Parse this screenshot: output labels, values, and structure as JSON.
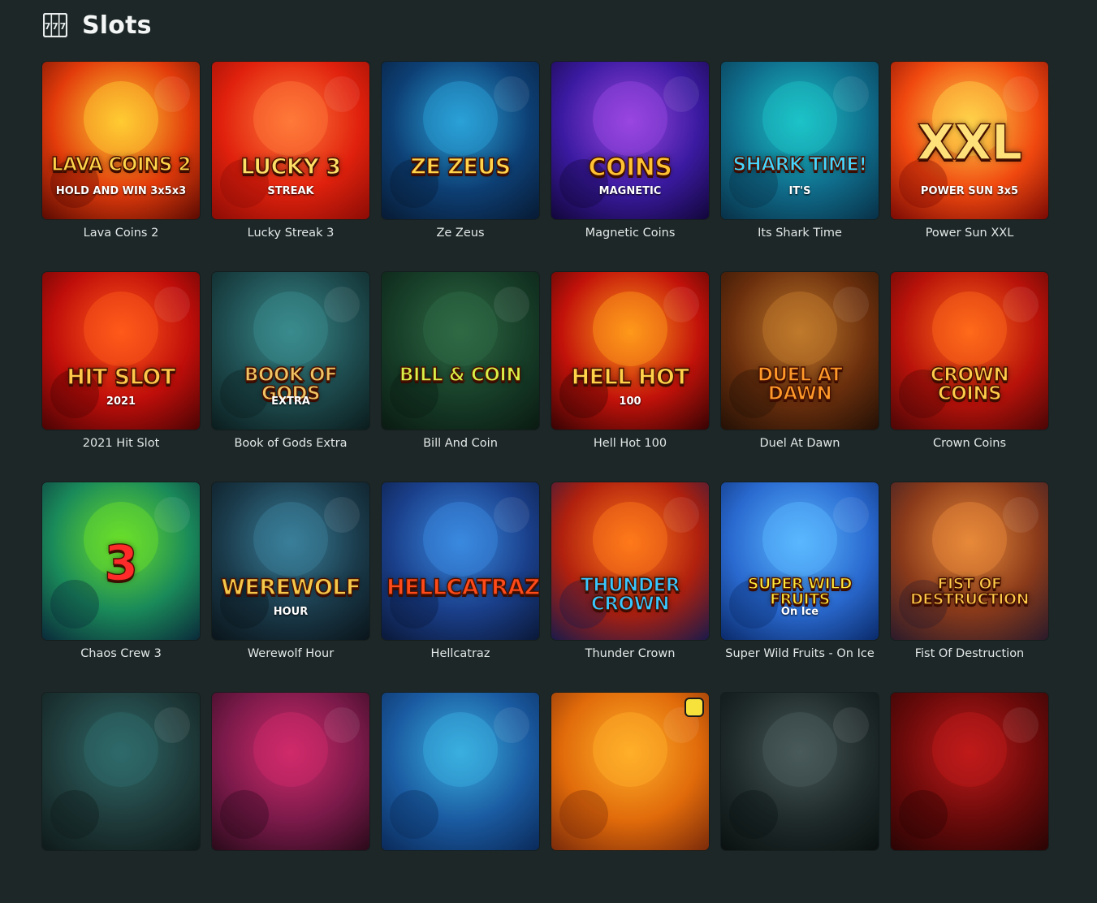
{
  "page": {
    "title": "Slots",
    "icon": "slot-machine-icon"
  },
  "games": [
    {
      "name": "Lava Coins 2",
      "logo": "Lava Coins 2",
      "sub": "HOLD AND WIN 3x5x3",
      "bg": [
        "#ffcc33",
        "#e23b0b",
        "#5a0a02"
      ],
      "logo_color": "#ffd54a"
    },
    {
      "name": "Lucky Streak 3",
      "logo": "Lucky 3",
      "sub": "STREAK",
      "bg": [
        "#ff7a3a",
        "#e0210d",
        "#8b0c05"
      ],
      "logo_color": "#ffe066"
    },
    {
      "name": "Ze Zeus",
      "logo": "Ze Zeus",
      "sub": "",
      "bg": [
        "#2aa1d8",
        "#0d3f74",
        "#071a33"
      ],
      "logo_color": "#ffd34a"
    },
    {
      "name": "Magnetic Coins",
      "logo": "Coins",
      "sub": "MAGNETIC",
      "bg": [
        "#9a46e0",
        "#3a1aa0",
        "#12063a"
      ],
      "logo_color": "#ffc233"
    },
    {
      "name": "Its Shark Time",
      "logo": "Shark Time!",
      "sub": "IT'S",
      "bg": [
        "#1cc3c8",
        "#0f6c8a",
        "#083047"
      ],
      "logo_color": "#45d7ff"
    },
    {
      "name": "Power Sun XXL",
      "logo": "XXL",
      "sub": "POWER SUN 3x5",
      "bg": [
        "#ffd24a",
        "#f0480f",
        "#7a0a04"
      ],
      "logo_color": "#ffe17a"
    },
    {
      "name": "2021 Hit Slot",
      "logo": "Hit Slot",
      "sub": "2021",
      "bg": [
        "#ff5a1a",
        "#c00e0a",
        "#4a0404"
      ],
      "logo_color": "#ffc84a"
    },
    {
      "name": "Book of Gods Extra",
      "logo": "Book of Gods",
      "sub": "EXTRA",
      "bg": [
        "#3a8b8d",
        "#1d4a4d",
        "#0b1c1d"
      ],
      "logo_color": "#f0c463"
    },
    {
      "name": "Bill And Coin",
      "logo": "Bill & Coin",
      "sub": "",
      "bg": [
        "#2f6a45",
        "#163c27",
        "#0a1a12"
      ],
      "logo_color": "#d8f047"
    },
    {
      "name": "Hell Hot 100",
      "logo": "Hell Hot",
      "sub": "100",
      "bg": [
        "#ff9a1a",
        "#c2120a",
        "#360303"
      ],
      "logo_color": "#ffd24a"
    },
    {
      "name": "Duel At Dawn",
      "logo": "Duel at Dawn",
      "sub": "",
      "bg": [
        "#c07a2c",
        "#6b2f0d",
        "#231005"
      ],
      "logo_color": "#ff9a2a"
    },
    {
      "name": "Crown Coins",
      "logo": "Crown Coins",
      "sub": "",
      "bg": [
        "#ff6a1a",
        "#b8120a",
        "#4a0606"
      ],
      "logo_color": "#ffcd4a"
    },
    {
      "name": "Chaos Crew 3",
      "logo": "3",
      "sub": "",
      "bg": [
        "#6adf2a",
        "#1a8a5a",
        "#0a2a3a"
      ],
      "logo_color": "#ff2a2a"
    },
    {
      "name": "Werewolf Hour",
      "logo": "Werewolf",
      "sub": "HOUR",
      "bg": [
        "#3a7f9a",
        "#1a3a4a",
        "#0a141a"
      ],
      "logo_color": "#f5c84a"
    },
    {
      "name": "Hellcatraz",
      "logo": "Hellcatraz",
      "sub": "",
      "bg": [
        "#3a8ae0",
        "#1a3f8a",
        "#0a1838"
      ],
      "logo_color": "#ff4a1a"
    },
    {
      "name": "Thunder Crown",
      "logo": "Thunder Crown",
      "sub": "",
      "bg": [
        "#ff7a1a",
        "#b0200e",
        "#1a1a4a"
      ],
      "logo_color": "#38c6ff"
    },
    {
      "name": "Super Wild Fruits - On Ice",
      "logo": "Super Wild Fruits",
      "sub": "On Ice",
      "bg": [
        "#5ab8ff",
        "#2a6ad0",
        "#0a2a6a"
      ],
      "logo_color": "#ffea3a"
    },
    {
      "name": "Fist Of Destruction",
      "logo": "Fist of Destruction",
      "sub": "",
      "bg": [
        "#e88a3a",
        "#8a3a1a",
        "#2a1a2a"
      ],
      "logo_color": "#ffcd4a"
    },
    {
      "name": "",
      "logo": "",
      "sub": "",
      "bg": [
        "#2f6a6a",
        "#1f3a3a",
        "#0f1a1a"
      ],
      "logo_color": "#ffffff"
    },
    {
      "name": "",
      "logo": "",
      "sub": "",
      "bg": [
        "#d02a6a",
        "#7a1a4a",
        "#2a0a1a"
      ],
      "logo_color": "#ffffff"
    },
    {
      "name": "",
      "logo": "",
      "sub": "",
      "bg": [
        "#3ab0e0",
        "#1a5aa0",
        "#0a2a5a"
      ],
      "logo_color": "#ffffff"
    },
    {
      "name": "",
      "logo": "",
      "sub": "",
      "bg": [
        "#ffb02a",
        "#e06a0a",
        "#7a2a0a"
      ],
      "logo_color": "#ffffff",
      "badge": true
    },
    {
      "name": "",
      "logo": "",
      "sub": "",
      "bg": [
        "#4a5a5a",
        "#1f2a2a",
        "#0a1010"
      ],
      "logo_color": "#ffffff"
    },
    {
      "name": "",
      "logo": "",
      "sub": "",
      "bg": [
        "#c01a1a",
        "#6a0a0a",
        "#2a0404"
      ],
      "logo_color": "#ffffff"
    }
  ]
}
